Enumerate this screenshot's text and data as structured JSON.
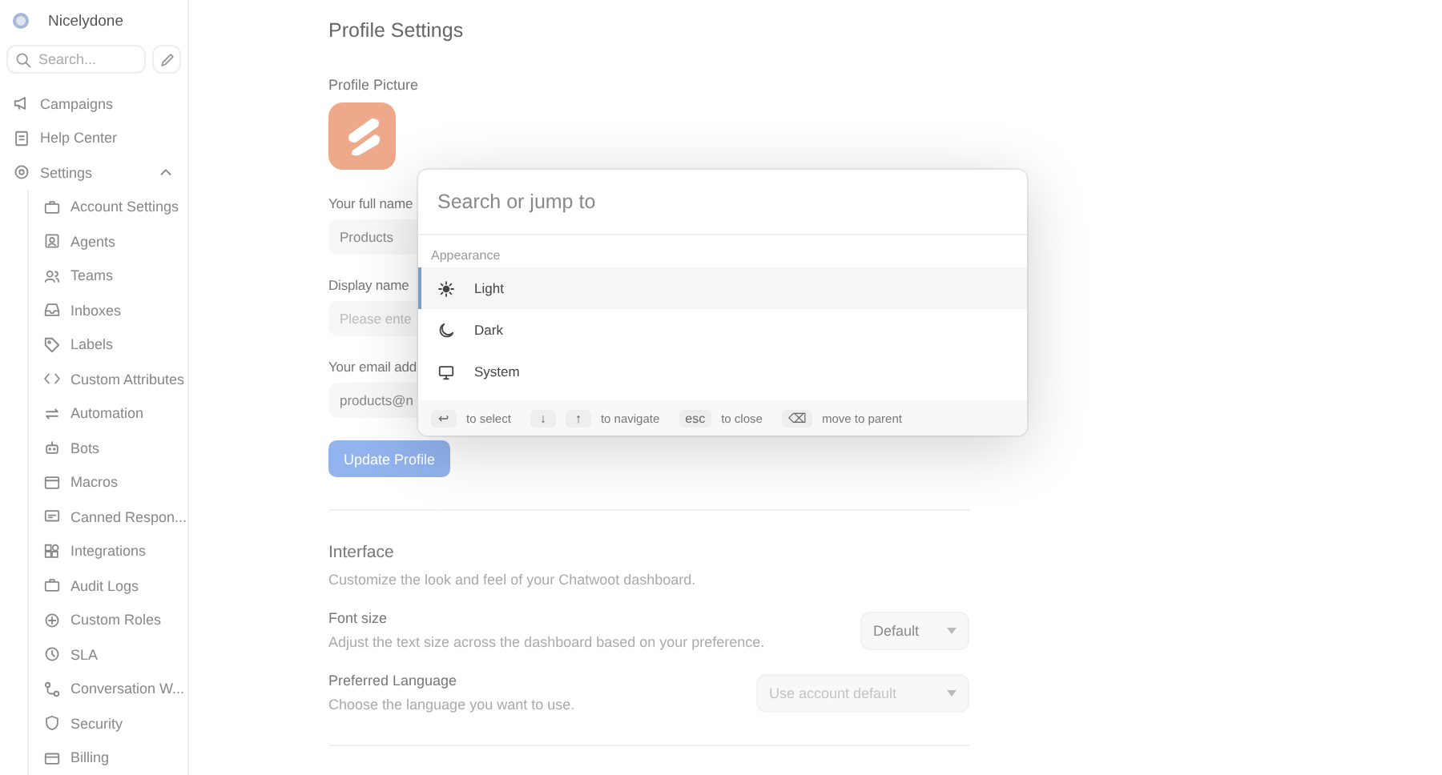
{
  "sidebar": {
    "account": "Nicelydone",
    "search": {
      "placeholder": "Search..."
    },
    "items": [
      {
        "label": "Campaigns"
      },
      {
        "label": "Help Center"
      },
      {
        "label": "Settings",
        "expanded": true,
        "children": [
          {
            "label": "Account Settings"
          },
          {
            "label": "Agents"
          },
          {
            "label": "Teams"
          },
          {
            "label": "Inboxes"
          },
          {
            "label": "Labels"
          },
          {
            "label": "Custom Attributes"
          },
          {
            "label": "Automation"
          },
          {
            "label": "Bots"
          },
          {
            "label": "Macros"
          },
          {
            "label": "Canned Respon..."
          },
          {
            "label": "Integrations"
          },
          {
            "label": "Audit Logs"
          },
          {
            "label": "Custom Roles"
          },
          {
            "label": "SLA"
          },
          {
            "label": "Conversation W..."
          },
          {
            "label": "Security"
          },
          {
            "label": "Billing"
          }
        ]
      }
    ]
  },
  "profile": {
    "title": "Profile Settings",
    "picture_label": "Profile Picture",
    "fields": [
      {
        "label": "Your full name",
        "value": "Products"
      },
      {
        "label": "Display name",
        "placeholder": "Please ente"
      },
      {
        "label": "Your email add",
        "value": "products@n"
      }
    ],
    "button": "Update Profile"
  },
  "interface": {
    "title": "Interface",
    "description": "Customize the look and feel of your Chatwoot dashboard.",
    "settings": [
      {
        "label": "Font size",
        "description": "Adjust the text size across the dashboard based on your preference.",
        "value": "Default",
        "disabled": false
      },
      {
        "label": "Preferred Language",
        "description": "Choose the language you want to use.",
        "value": "Use account default",
        "disabled": true
      }
    ]
  },
  "command_palette": {
    "placeholder": "Search or jump to",
    "group": "Appearance",
    "items": [
      {
        "label": "Light",
        "selected": true
      },
      {
        "label": "Dark",
        "selected": false
      },
      {
        "label": "System",
        "selected": false
      }
    ],
    "hints": [
      {
        "keys": [
          "↩"
        ],
        "label": "to select"
      },
      {
        "keys": [
          "↓",
          "↑"
        ],
        "label": "to navigate"
      },
      {
        "keys": [
          "esc"
        ],
        "label": "to close"
      },
      {
        "keys": [
          "⌫"
        ],
        "label": "move to parent"
      }
    ]
  }
}
